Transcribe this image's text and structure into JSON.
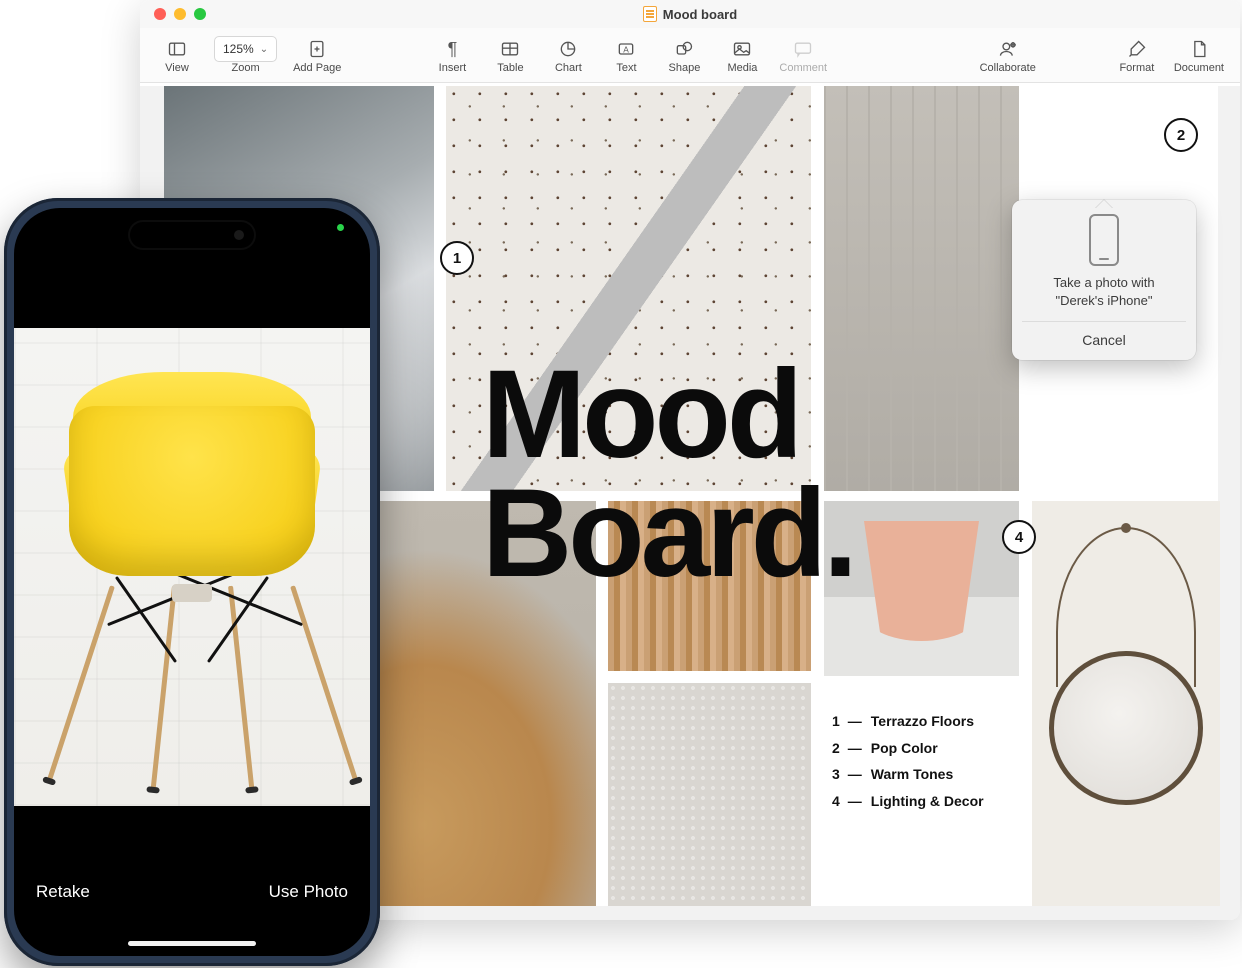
{
  "window": {
    "title": "Mood board"
  },
  "toolbar": {
    "view": {
      "label": "View"
    },
    "zoom": {
      "label": "Zoom",
      "value": "125%"
    },
    "addpage": {
      "label": "Add Page"
    },
    "insert": {
      "label": "Insert"
    },
    "table": {
      "label": "Table"
    },
    "chart": {
      "label": "Chart"
    },
    "text": {
      "label": "Text"
    },
    "shape": {
      "label": "Shape"
    },
    "media": {
      "label": "Media"
    },
    "comment": {
      "label": "Comment"
    },
    "collab": {
      "label": "Collaborate"
    },
    "format": {
      "label": "Format"
    },
    "document": {
      "label": "Document"
    }
  },
  "doc": {
    "headline_line1": "Mood",
    "headline_line2": "Board.",
    "callouts": {
      "c1": "1",
      "c2": "2",
      "c4": "4"
    },
    "legend": [
      {
        "n": "1",
        "text": "Terrazzo Floors"
      },
      {
        "n": "2",
        "text": "Pop Color"
      },
      {
        "n": "3",
        "text": "Warm Tones"
      },
      {
        "n": "4",
        "text": "Lighting & Decor"
      }
    ]
  },
  "popover": {
    "line1": "Take a photo with",
    "line2": "\"Derek's iPhone\"",
    "cancel": "Cancel"
  },
  "iphone": {
    "retake": "Retake",
    "use": "Use Photo"
  }
}
